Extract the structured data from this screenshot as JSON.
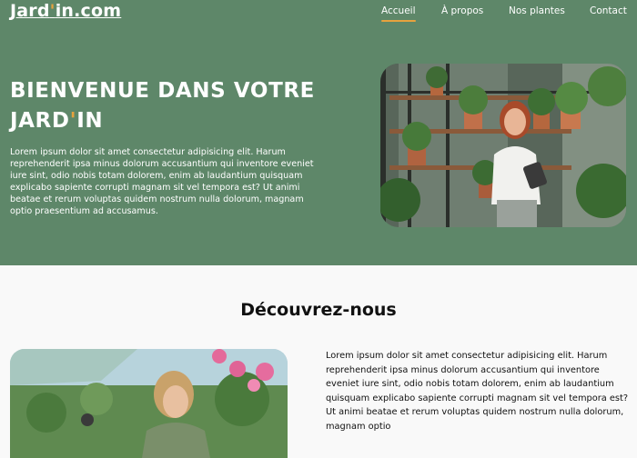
{
  "header": {
    "logo_main": "Jard",
    "logo_apos": "'",
    "logo_rest": "in.com",
    "nav": [
      {
        "label": "Accueil",
        "active": true
      },
      {
        "label": "À propos",
        "active": false
      },
      {
        "label": "Nos plantes",
        "active": false
      },
      {
        "label": "Contact",
        "active": false
      }
    ]
  },
  "hero": {
    "title_line1": "BIENVENUE DANS VOTRE",
    "title_line2_main": "JARD",
    "title_line2_apos": "'",
    "title_line2_rest": "IN",
    "text": "Lorem ipsum dolor sit amet consectetur adipisicing elit. Harum reprehenderit ipsa minus dolorum accusantium qui inventore eveniet iure sint, odio nobis totam dolorem, enim ab laudantium quisquam explicabo sapiente corrupti magnam sit vel tempora est? Ut animi beatae et rerum voluptas quidem nostrum nulla dolorum, magnam optio praesentium ad accusamus."
  },
  "section": {
    "title": "Découvrez-nous",
    "text": "Lorem ipsum dolor sit amet consectetur adipisicing elit. Harum reprehenderit ipsa minus dolorum accusantium qui inventore eveniet iure sint, odio nobis totam dolorem, enim ab laudantium quisquam explicabo sapiente corrupti magnam sit vel tempora est? Ut animi beatae et rerum voluptas quidem nostrum nulla dolorum, magnam optio"
  },
  "colors": {
    "hero_bg": "#5e8769",
    "accent": "#e7a23e",
    "page_bg": "#f9f9f9",
    "text_dark": "#111111"
  }
}
